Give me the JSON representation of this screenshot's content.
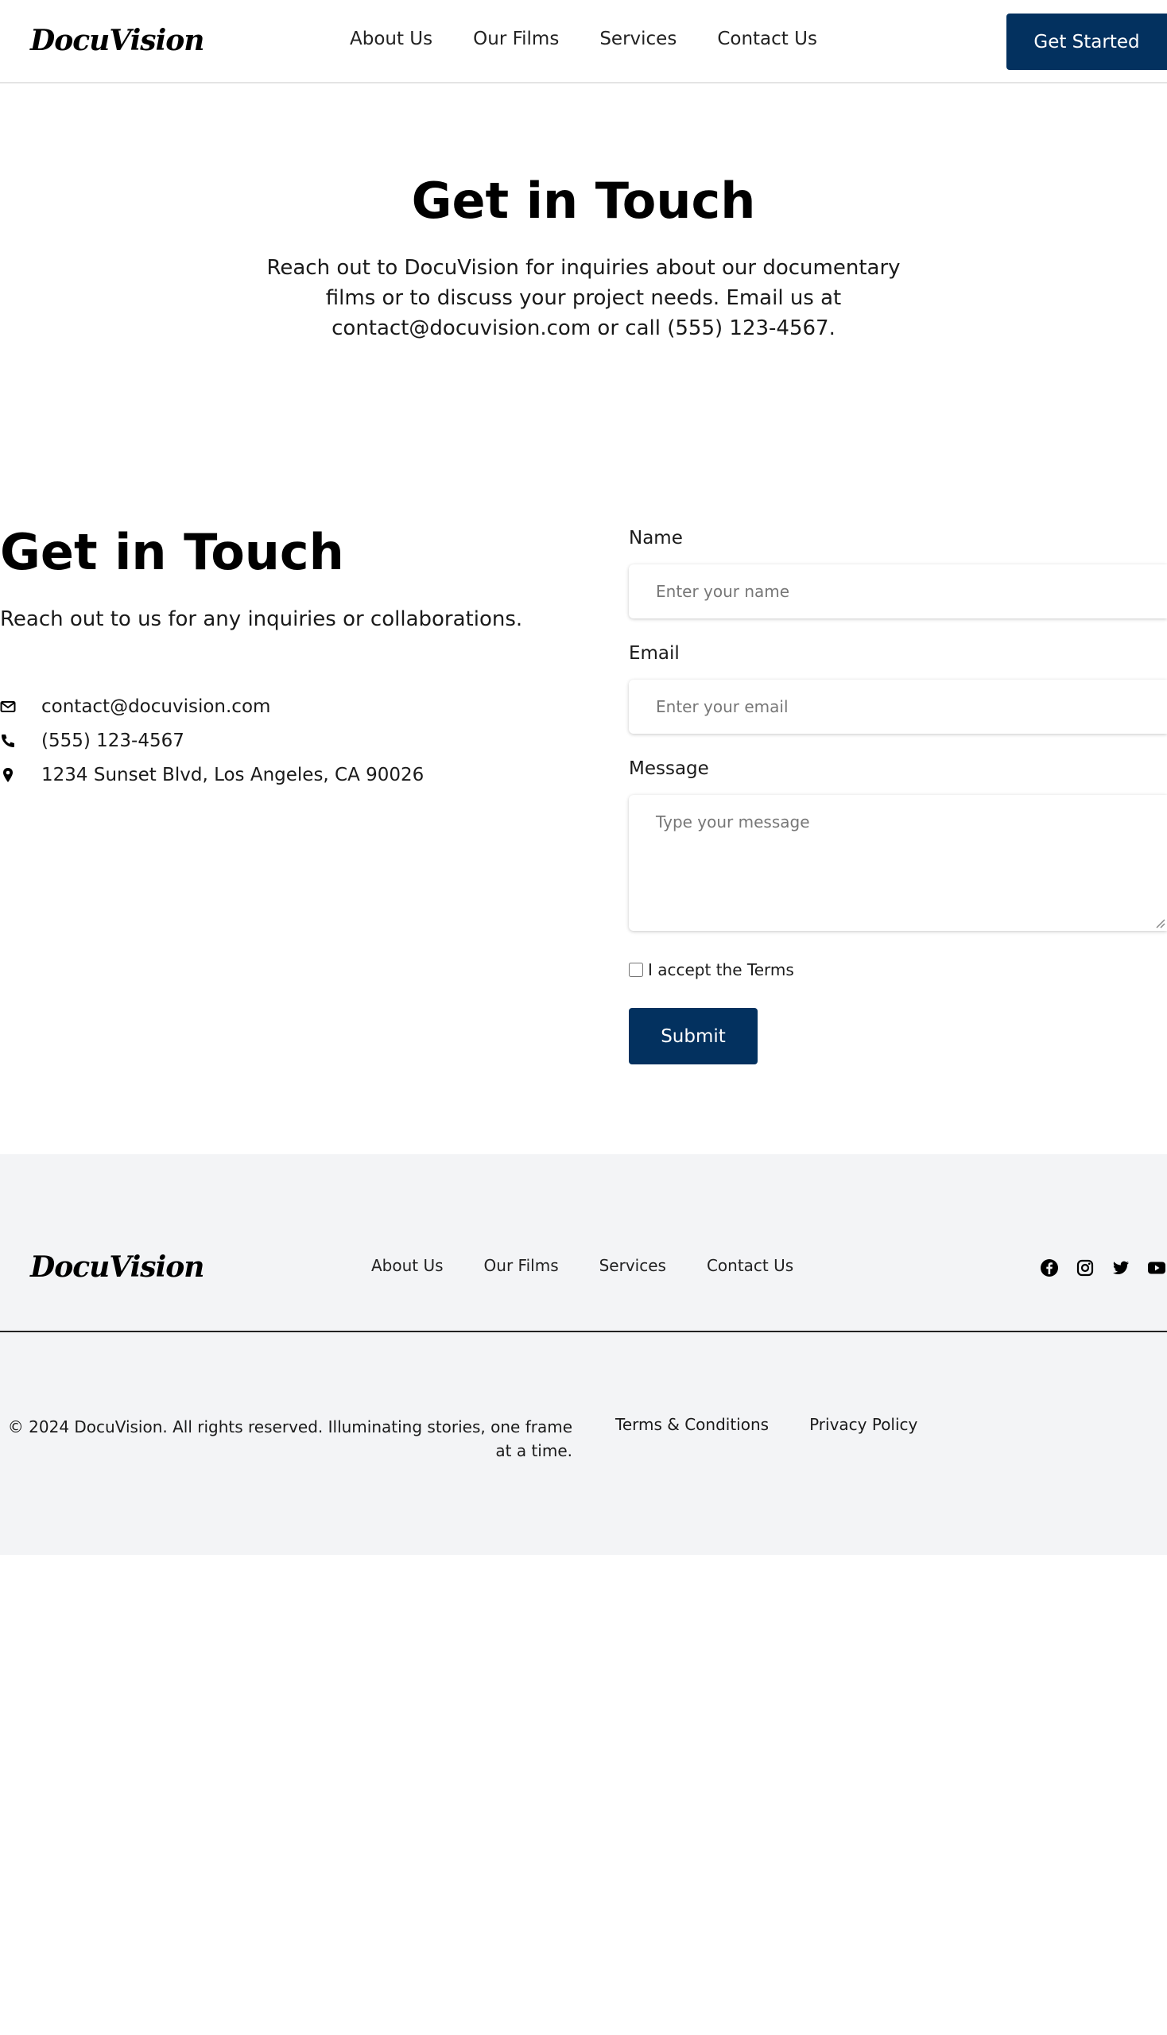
{
  "header": {
    "logo": "DocuVision",
    "nav": [
      "About Us",
      "Our Films",
      "Services",
      "Contact Us"
    ],
    "cta_label": "Get Started"
  },
  "hero": {
    "title": "Get in Touch",
    "text": "Reach out to DocuVision for inquiries about our documentary films or to discuss your project needs. Email us at contact@docuvision.com or call (555) 123-4567."
  },
  "contact": {
    "title": "Get in Touch",
    "subtitle": "Reach out to us for any inquiries or collaborations.",
    "email": "contact@docuvision.com",
    "phone": "(555) 123-4567",
    "address": "1234 Sunset Blvd, Los Angeles, CA 90026"
  },
  "form": {
    "name_label": "Name",
    "name_placeholder": "Enter your name",
    "email_label": "Email",
    "email_placeholder": "Enter your email",
    "message_label": "Message",
    "message_placeholder": "Type your message",
    "terms_label": "I accept the Terms",
    "submit_label": "Submit"
  },
  "footer": {
    "logo": "DocuVision",
    "nav": [
      "About Us",
      "Our Films",
      "Services",
      "Contact Us"
    ],
    "socials": [
      "facebook-icon",
      "instagram-icon",
      "twitter-icon",
      "youtube-icon"
    ],
    "copyright": "© 2024 DocuVision. All rights reserved. Illuminating stories, one frame at a time.",
    "legal": [
      "Terms & Conditions",
      "Privacy Policy"
    ]
  },
  "colors": {
    "accent": "#03315f",
    "footer_bg": "#f3f4f6"
  }
}
